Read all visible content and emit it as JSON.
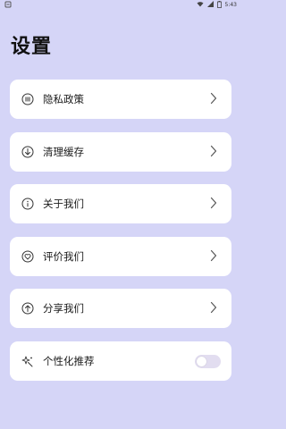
{
  "status_bar": {
    "left_icon": "app-notification-icon",
    "time": "5:43",
    "icons": [
      "wifi-icon",
      "signal-icon",
      "battery-icon"
    ]
  },
  "page_title": "设置",
  "menu": [
    {
      "label": "隐私政策",
      "icon": "privacy-icon"
    },
    {
      "label": "清理缓存",
      "icon": "clear-cache-icon"
    },
    {
      "label": "关于我们",
      "icon": "info-icon"
    },
    {
      "label": "评价我们",
      "icon": "heart-icon"
    },
    {
      "label": "分享我们",
      "icon": "share-icon"
    }
  ],
  "personalized": {
    "label": "个性化推荐",
    "icon": "sparkle-icon",
    "enabled": false
  }
}
